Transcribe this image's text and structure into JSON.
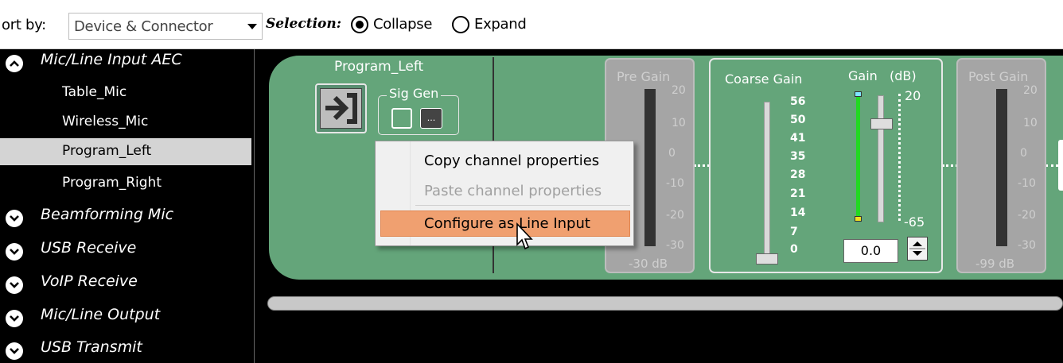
{
  "toolbar": {
    "sort_label": "ort by:",
    "sort_value": "Device & Connector",
    "selection_label": "Selection:",
    "options": [
      {
        "label": "Collapse",
        "selected": true
      },
      {
        "label": "Expand",
        "selected": false
      }
    ]
  },
  "tree": {
    "categories": [
      {
        "label": "Mic/Line Input AEC",
        "expanded": true,
        "items": [
          "Table_Mic",
          "Wireless_Mic",
          "Program_Left",
          "Program_Right"
        ],
        "selected_item": "Program_Left"
      },
      {
        "label": "Beamforming Mic",
        "expanded": false
      },
      {
        "label": "USB Receive",
        "expanded": false
      },
      {
        "label": "VoIP Receive",
        "expanded": false
      },
      {
        "label": "Mic/Line Output",
        "expanded": false
      },
      {
        "label": "USB Transmit",
        "expanded": false
      }
    ]
  },
  "channel": {
    "name": "Program_Left",
    "sig_gen_label": "Sig Gen",
    "sig_gen_button": "..."
  },
  "pre_gain": {
    "title": "Pre Gain",
    "scale": [
      "20",
      "10",
      "0",
      "-10",
      "-20",
      "-30"
    ],
    "readout": "-30 dB"
  },
  "coarse_gain": {
    "title": "Coarse Gain",
    "scale": [
      "56",
      "50",
      "41",
      "35",
      "28",
      "21",
      "14",
      "7",
      "0"
    ]
  },
  "gain": {
    "title": "Gain",
    "unit": "(dB)",
    "max": "20",
    "min": "-65",
    "value": "0.0"
  },
  "post_gain": {
    "title": "Post Gain",
    "scale": [
      "20",
      "10",
      "0",
      "-10",
      "-20",
      "-30"
    ],
    "readout": "-99 dB"
  },
  "context_menu": {
    "items": [
      {
        "label": "Copy channel properties",
        "enabled": true
      },
      {
        "label": "Paste channel properties",
        "enabled": false
      },
      {
        "label": "Configure as Line Input",
        "enabled": true,
        "highlighted": true
      }
    ]
  },
  "colors": {
    "strip_green": "#64a57a",
    "menu_highlight": "#f0a070",
    "disabled_panel": "#a5a5a5"
  }
}
